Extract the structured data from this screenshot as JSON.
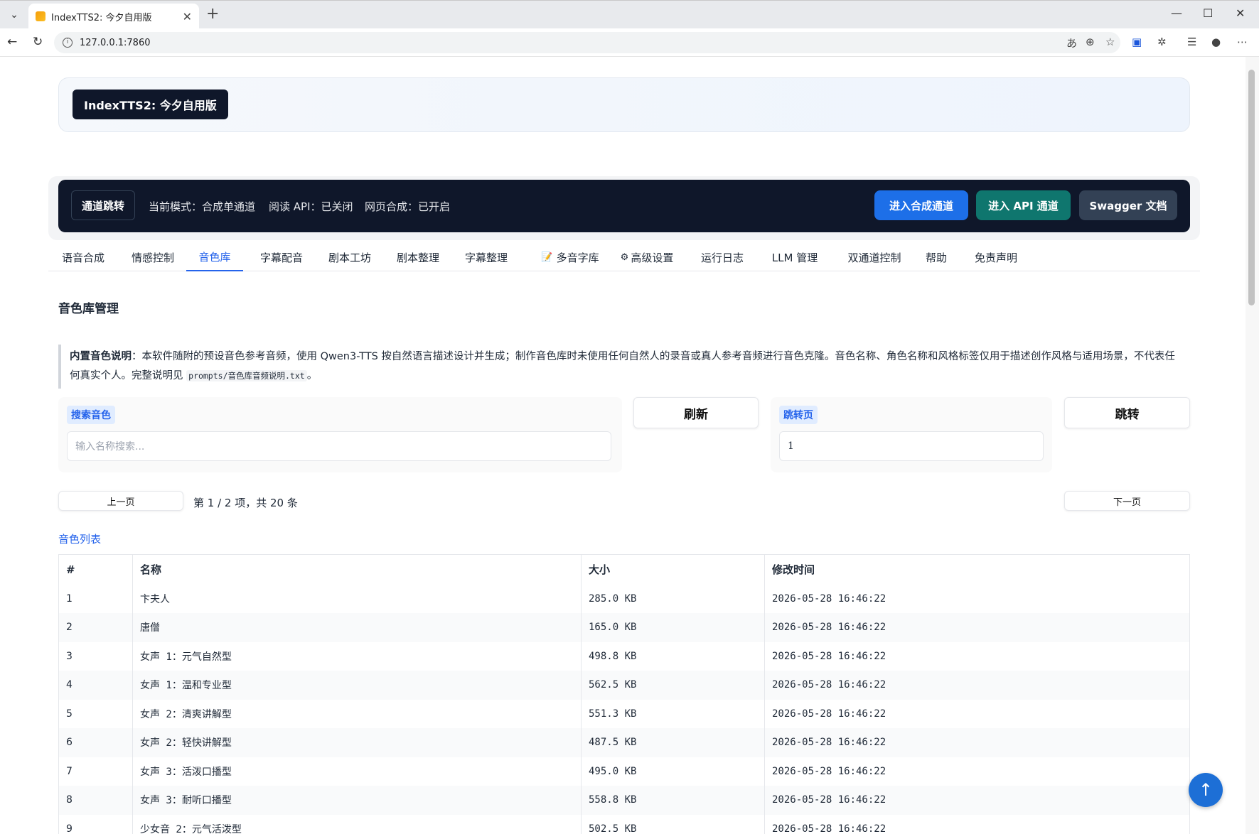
{
  "browser": {
    "tab_title": "IndexTTS2: 今夕自用版",
    "url": "127.0.0.1:7860"
  },
  "hero": {
    "badge": "IndexTTS2: 今夕自用版"
  },
  "channel": {
    "badge": "通道跳转",
    "mode": "当前模式：合成单通道",
    "api": "阅读 API：已关闭",
    "web": "网页合成：已开启",
    "btn_synth": "进入合成通道",
    "btn_api": "进入 API 通道",
    "btn_swagger": "Swagger 文档",
    "colors": {
      "synth": "#1d6fe8",
      "api": "#0f766e",
      "swagger": "#334155"
    }
  },
  "tabs": [
    "语音合成",
    "情感控制",
    "音色库",
    "字幕配音",
    "剧本工坊",
    "剧本整理",
    "字幕整理",
    "多音字库",
    "高级设置",
    "运行日志",
    "LLM 管理",
    "双通道控制",
    "帮助",
    "免责声明"
  ],
  "active_tab": "音色库",
  "section_title": "音色库管理",
  "notice": {
    "bold": "内置音色说明",
    "text": "：本软件随附的预设音色参考音频，使用 Qwen3-TTS 按自然语言描述设计并生成；制作音色库时未使用任何自然人的录音或真人参考音频进行音色克隆。音色名称、角色名称和风格标签仅用于描述创作风格与适用场景，不代表任何真实个人。完整说明见 ",
    "code": "prompts/音色库音频说明.txt",
    "end": "。"
  },
  "search": {
    "label": "搜索音色",
    "placeholder": "输入名称搜索..."
  },
  "refresh_label": "刷新",
  "jump": {
    "label": "跳转页",
    "value": "1",
    "button": "跳转"
  },
  "pager": {
    "prev": "上一页",
    "info": "第 1 / 2 项，共 20 条",
    "next": "下一页"
  },
  "list_title": "音色列表",
  "table": {
    "headers": [
      "#",
      "名称",
      "大小",
      "修改时间"
    ],
    "rows": [
      [
        "1",
        "卞夫人",
        "285.0 KB",
        "2026-05-28 16:46:22"
      ],
      [
        "2",
        "唐僧",
        "165.0 KB",
        "2026-05-28 16:46:22"
      ],
      [
        "3",
        "女声 1：元气自然型",
        "498.8 KB",
        "2026-05-28 16:46:22"
      ],
      [
        "4",
        "女声 1：温和专业型",
        "562.5 KB",
        "2026-05-28 16:46:22"
      ],
      [
        "5",
        "女声 2：清爽讲解型",
        "551.3 KB",
        "2026-05-28 16:46:22"
      ],
      [
        "6",
        "女声 2：轻快讲解型",
        "487.5 KB",
        "2026-05-28 16:46:22"
      ],
      [
        "7",
        "女声 3：活泼口播型",
        "495.0 KB",
        "2026-05-28 16:46:22"
      ],
      [
        "8",
        "女声 3：耐听口播型",
        "558.8 KB",
        "2026-05-28 16:46:22"
      ],
      [
        "9",
        "少女音 2：元气活泼型",
        "502.5 KB",
        "2026-05-28 16:46:22"
      ]
    ]
  },
  "icons": {
    "back": "arrow-left-icon",
    "reload": "reload-icon",
    "top": "arrow-up-icon"
  }
}
